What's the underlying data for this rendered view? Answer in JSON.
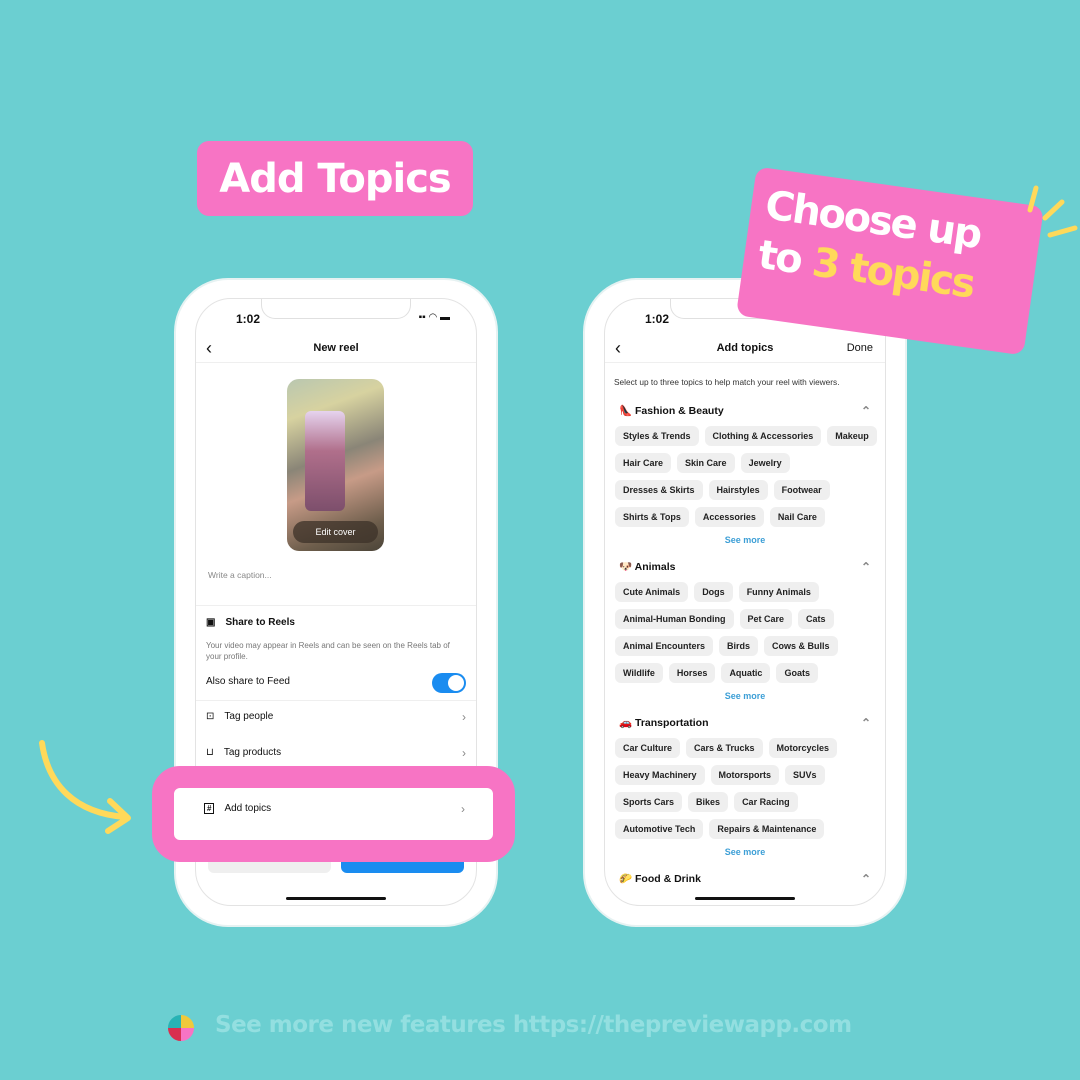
{
  "headline": "Add Topics",
  "callout": {
    "line1": "Choose up",
    "line2_prefix": "to ",
    "line2_highlight": "3 topics"
  },
  "footer": "See more new features https://thepreviewapp.com",
  "colors": {
    "background": "#6bcfd1",
    "pink": "#f774c4",
    "yellow": "#ffd95a",
    "toggle": "#1a8cf0"
  },
  "left_phone": {
    "time": "1:02",
    "title": "New reel",
    "cover_label": "Edit cover",
    "caption_placeholder": "Write a caption...",
    "share_title": "Share to Reels",
    "share_desc": "Your video may appear in Reels and can be seen on the Reels tab of your profile.",
    "feed_toggle_label": "Also share to Feed",
    "feed_toggle_on": true,
    "items": [
      {
        "label": "Tag people",
        "icon": "tag-person-icon"
      },
      {
        "label": "Tag products",
        "icon": "shopping-bag-icon"
      },
      {
        "label": "Add topics",
        "icon": "hashtag-icon"
      }
    ]
  },
  "right_phone": {
    "time": "1:02",
    "title": "Add topics",
    "done": "Done",
    "description": "Select up to three topics to help match your reel with viewers.",
    "see_more": "See more",
    "sections": [
      {
        "emoji": "👠",
        "name": "Fashion & Beauty",
        "rows": [
          [
            "Styles & Trends",
            "Clothing & Accessories",
            "Makeup"
          ],
          [
            "Hair Care",
            "Skin Care",
            "Jewelry"
          ],
          [
            "Dresses & Skirts",
            "Hairstyles",
            "Footwear"
          ],
          [
            "Shirts & Tops",
            "Accessories",
            "Nail Care"
          ]
        ]
      },
      {
        "emoji": "🐶",
        "name": "Animals",
        "rows": [
          [
            "Cute Animals",
            "Dogs",
            "Funny Animals"
          ],
          [
            "Animal-Human Bonding",
            "Pet Care",
            "Cats"
          ],
          [
            "Animal Encounters",
            "Birds",
            "Cows & Bulls"
          ],
          [
            "Wildlife",
            "Horses",
            "Aquatic",
            "Goats"
          ]
        ]
      },
      {
        "emoji": "🚗",
        "name": "Transportation",
        "rows": [
          [
            "Car Culture",
            "Cars & Trucks",
            "Motorcycles"
          ],
          [
            "Heavy Machinery",
            "Motorsports",
            "SUVs"
          ],
          [
            "Sports Cars",
            "Bikes",
            "Car Racing"
          ],
          [
            "Automotive Tech",
            "Repairs & Maintenance"
          ]
        ]
      },
      {
        "emoji": "🌮",
        "name": "Food & Drink",
        "rows": []
      }
    ]
  }
}
